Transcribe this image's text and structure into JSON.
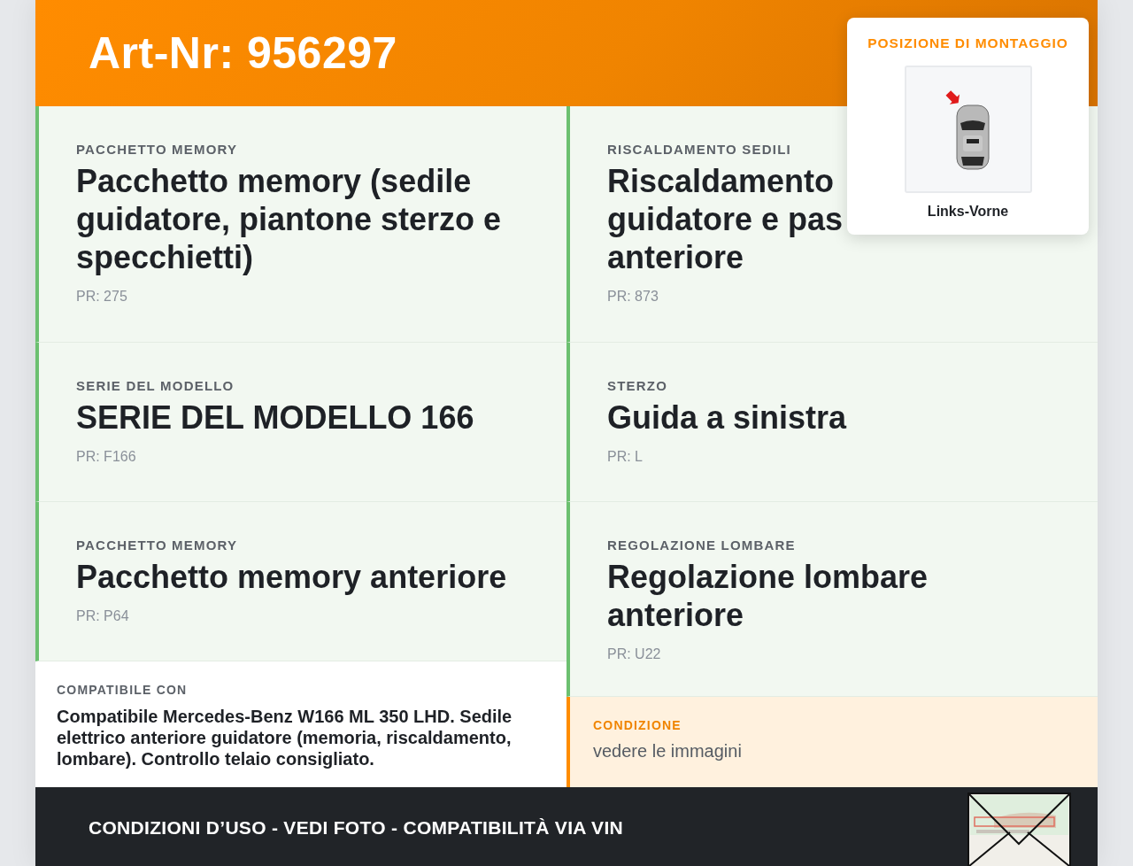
{
  "header": {
    "title": "Art-Nr: 956297"
  },
  "mount_position": {
    "title": "POSIZIONE DI MONTAGGIO",
    "label": "Links-Vorne"
  },
  "features": [
    {
      "label": "PACCHETTO MEMORY",
      "title": "Pacchetto memory (sedile guidatore, piantone sterzo e specchietti)",
      "code": "PR: 275"
    },
    {
      "label": "RISCALDAMENTO SEDILI",
      "title_lines": [
        "Riscaldamento",
        "guidatore e pas",
        "anteriore"
      ],
      "code": "PR: 873"
    },
    {
      "label": "SERIE DEL MODELLO",
      "title": "SERIE DEL MODELLO 166",
      "code": "PR: F166"
    },
    {
      "label": "STERZO",
      "title": "Guida a sinistra",
      "code": "PR: L"
    },
    {
      "label": "PACCHETTO MEMORY",
      "title": "Pacchetto memory anteriore",
      "code": "PR: P64"
    },
    {
      "label": "REGOLAZIONE LOMBARE",
      "title": "Regolazione lombare anteriore",
      "code": "PR: U22"
    }
  ],
  "compatibility": {
    "label": "COMPATIBILE CON",
    "text": "Compatibile Mercedes-Benz W166 ML 350 LHD. Sedile elettrico anteriore guidatore (memoria, riscaldamento, lombare). Controllo telaio consigliato."
  },
  "condition": {
    "label": "CONDIZIONE",
    "text": "vedere le immagini"
  },
  "footer": {
    "text": "CONDIZIONI D’USO - VEDI FOTO - COMPATIBILITÀ VIA VIN"
  }
}
